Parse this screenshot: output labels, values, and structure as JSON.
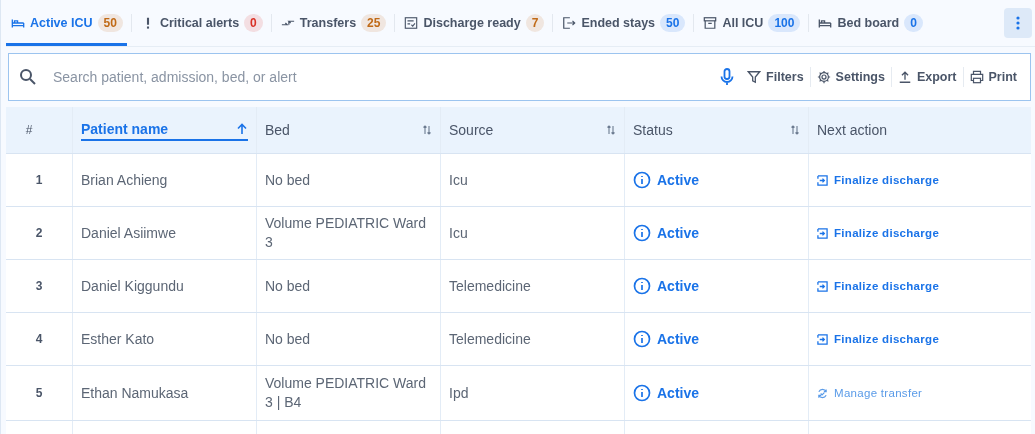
{
  "tabs": [
    {
      "label": "Active ICU",
      "count": "50",
      "color": "#c06a17",
      "selected": true
    },
    {
      "label": "Critical alerts",
      "count": "0",
      "color": "#d93025",
      "selected": false
    },
    {
      "label": "Transfers",
      "count": "25",
      "color": "#c06a17",
      "selected": false
    },
    {
      "label": "Discharge ready",
      "count": "7",
      "color": "#c06a17",
      "selected": false
    },
    {
      "label": "Ended stays",
      "count": "50",
      "color": "#1a73e8",
      "selected": false
    },
    {
      "label": "All ICU",
      "count": "100",
      "color": "#1a73e8",
      "selected": false
    },
    {
      "label": "Bed board",
      "count": "0",
      "color": "#1a73e8",
      "selected": false
    }
  ],
  "search": {
    "placeholder": "Search patient, admission, bed, or alert"
  },
  "toolbar": [
    {
      "label": "Filters"
    },
    {
      "label": "Settings"
    },
    {
      "label": "Export"
    },
    {
      "label": "Print"
    }
  ],
  "table": {
    "columns": [
      {
        "label": "#",
        "kind": "plain"
      },
      {
        "label": "Patient name",
        "kind": "sorted"
      },
      {
        "label": "Bed",
        "kind": "sortable"
      },
      {
        "label": "Source",
        "kind": "sortable"
      },
      {
        "label": "Status",
        "kind": "sortable"
      },
      {
        "label": "Next action",
        "kind": "plain"
      }
    ],
    "rows": [
      {
        "index": "1",
        "patient": "Brian Achieng",
        "bed": "No bed",
        "source": "Icu",
        "status": "Active",
        "action": {
          "kind": "discharge",
          "label": "Finalize discharge"
        }
      },
      {
        "index": "2",
        "patient": "Daniel Asiimwe",
        "bed": "Volume PEDIATRIC Ward 3",
        "source": "Icu",
        "status": "Active",
        "action": {
          "kind": "discharge",
          "label": "Finalize discharge"
        }
      },
      {
        "index": "3",
        "patient": "Daniel Kiggundu",
        "bed": "No bed",
        "source": "Telemedicine",
        "status": "Active",
        "action": {
          "kind": "discharge",
          "label": "Finalize discharge"
        }
      },
      {
        "index": "4",
        "patient": "Esther Kato",
        "bed": "No bed",
        "source": "Telemedicine",
        "status": "Active",
        "action": {
          "kind": "discharge",
          "label": "Finalize discharge"
        }
      },
      {
        "index": "5",
        "patient": "Ethan Namukasa",
        "bed": "Volume PEDIATRIC Ward 3 | B4",
        "source": "Ipd",
        "status": "Active",
        "action": {
          "kind": "transfer",
          "label": "Manage transfer"
        }
      }
    ]
  }
}
